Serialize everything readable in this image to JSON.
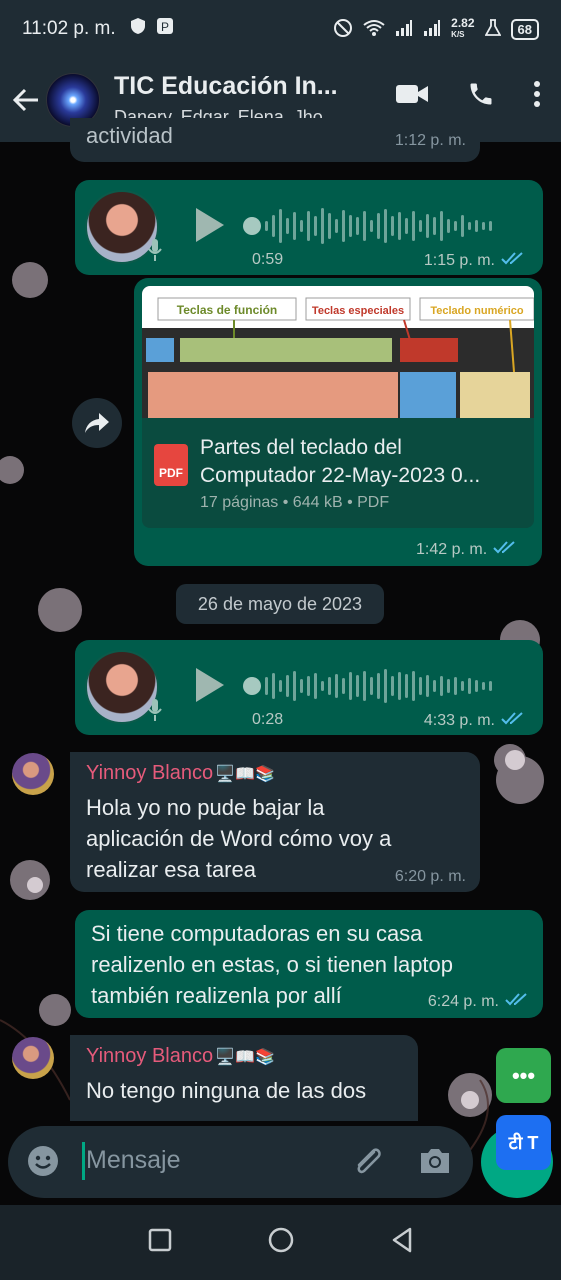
{
  "status_bar": {
    "time": "11:02 p. m.",
    "net_speed_value": "2.82",
    "net_speed_unit": "K/S",
    "battery": "68"
  },
  "header": {
    "title": "TIC  Educación In...",
    "members": "Danery, Edgar, Elena, Jho..."
  },
  "top_partial": {
    "text": "actividad",
    "time": "1:12 p. m."
  },
  "voice_messages": [
    {
      "duration": "0:59",
      "time": "1:15 p. m."
    },
    {
      "duration": "0:28",
      "time": "4:33 p. m."
    }
  ],
  "document": {
    "title_line1": "Partes del teclado del",
    "title_line2": "Computador 22-May-2023 0...",
    "pages": "17 páginas",
    "size": "644 kB",
    "type": "PDF",
    "icon_label": "PDF",
    "time": "1:42 p. m.",
    "preview_labels": [
      "Teclas de función",
      "Teclas especiales",
      "Teclado numérico"
    ]
  },
  "date_separator": "26 de mayo de 2023",
  "messages": [
    {
      "sender": "Yinnoy Blanco",
      "sender_emoji": "🖥️📖📚",
      "lines": [
        "Hola yo no pude bajar la",
        "aplicación de Word cómo voy a",
        "realizar esa tarea"
      ],
      "time": "6:20 p. m."
    },
    {
      "lines": [
        "Si tiene computadoras en su casa",
        "realizenlo en estas, o si tienen laptop",
        "también realizenla por allí"
      ],
      "time": "6:24 p. m."
    },
    {
      "sender": "Yinnoy Blanco",
      "sender_emoji": "🖥️📖📚",
      "lines": [
        "No tengo ninguna de las dos"
      ]
    }
  ],
  "composer": {
    "placeholder": "Mensaje"
  },
  "floating": {
    "green_label": "•••",
    "translate_label": "टी T"
  },
  "colors": {
    "outgoing_bubble": "#005c4b",
    "incoming_bubble": "#1f2c34",
    "accent": "#00a884",
    "sender_name": "#e65b7b"
  }
}
